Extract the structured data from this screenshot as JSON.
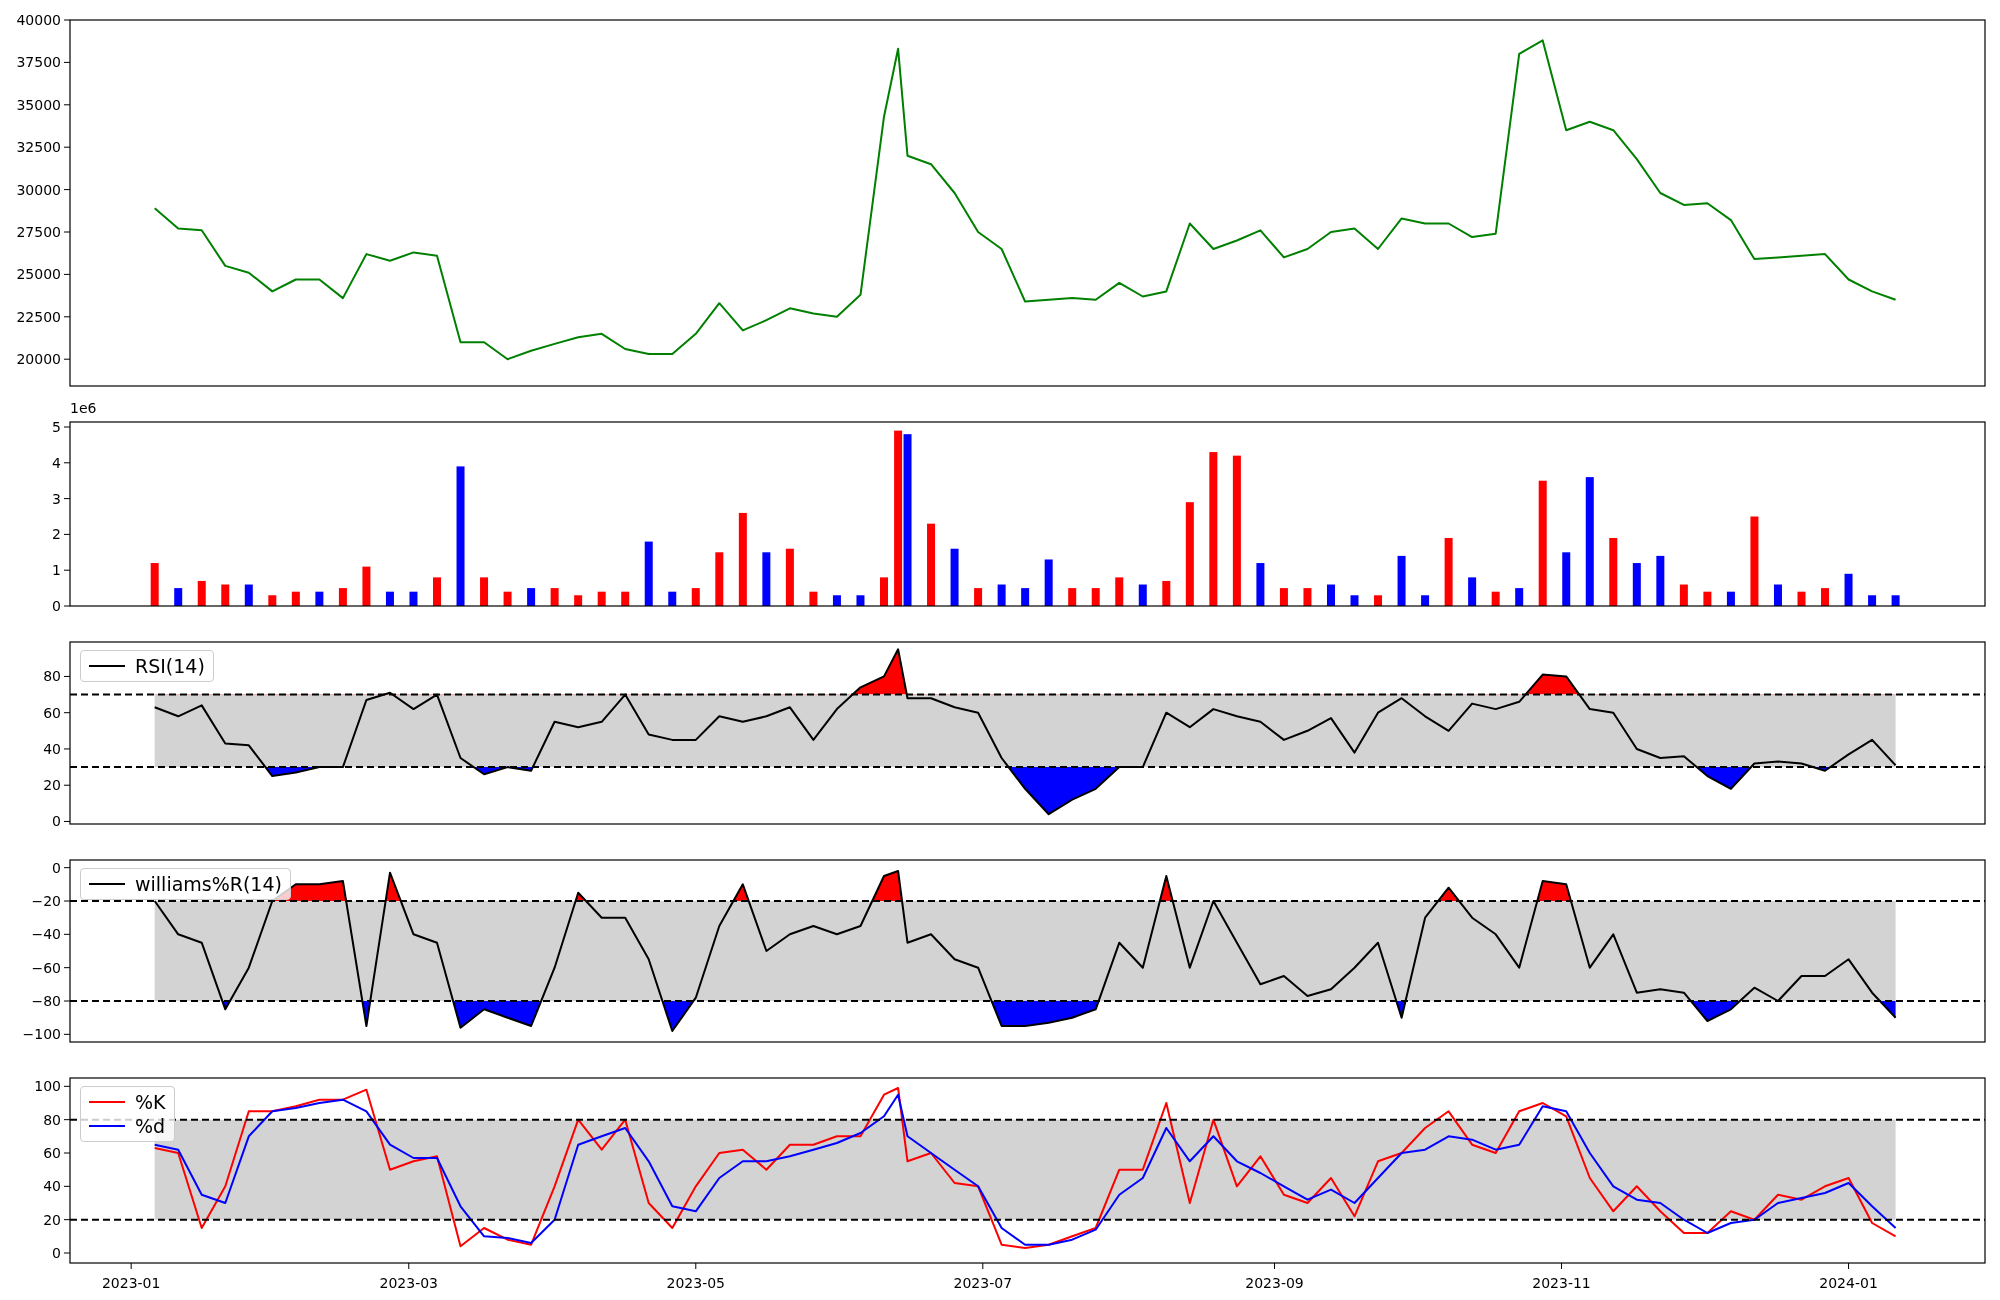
{
  "panels": [
    {
      "chart_data": {
        "type": "line",
        "x": [
          "2023-01-06",
          "2023-01-11",
          "2023-01-16",
          "2023-01-21",
          "2023-01-26",
          "2023-01-31",
          "2023-02-05",
          "2023-02-10",
          "2023-02-15",
          "2023-02-20",
          "2023-02-25",
          "2023-03-02",
          "2023-03-07",
          "2023-03-12",
          "2023-03-17",
          "2023-03-22",
          "2023-03-27",
          "2023-04-01",
          "2023-04-06",
          "2023-04-11",
          "2023-04-16",
          "2023-04-21",
          "2023-04-26",
          "2023-05-01",
          "2023-05-06",
          "2023-05-11",
          "2023-05-16",
          "2023-05-21",
          "2023-05-26",
          "2023-05-31",
          "2023-06-05",
          "2023-06-10",
          "2023-06-13",
          "2023-06-15",
          "2023-06-20",
          "2023-06-25",
          "2023-06-30",
          "2023-07-05",
          "2023-07-10",
          "2023-07-15",
          "2023-07-20",
          "2023-07-25",
          "2023-07-30",
          "2023-08-04",
          "2023-08-09",
          "2023-08-14",
          "2023-08-19",
          "2023-08-24",
          "2023-08-29",
          "2023-09-03",
          "2023-09-08",
          "2023-09-13",
          "2023-09-18",
          "2023-09-23",
          "2023-09-28",
          "2023-10-03",
          "2023-10-08",
          "2023-10-13",
          "2023-10-18",
          "2023-10-23",
          "2023-10-28",
          "2023-11-02",
          "2023-11-07",
          "2023-11-12",
          "2023-11-17",
          "2023-11-22",
          "2023-11-27",
          "2023-12-02",
          "2023-12-07",
          "2023-12-12",
          "2023-12-17",
          "2023-12-22",
          "2023-12-27",
          "2024-01-01",
          "2024-01-06",
          "2024-01-11"
        ],
        "xlim": [
          "2022-12-19",
          "2024-01-30"
        ],
        "ylim": [
          18420,
          40000
        ],
        "yticks": [
          20000,
          22500,
          25000,
          27500,
          30000,
          32500,
          35000,
          37500,
          40000
        ],
        "series": [
          {
            "color": "#008000",
            "values": [
              28900,
              27700,
              27600,
              25500,
              25100,
              24000,
              24700,
              24700,
              23600,
              26200,
              25800,
              26300,
              26100,
              21000,
              21000,
              20000,
              20500,
              20900,
              21300,
              21500,
              20600,
              20300,
              20300,
              21500,
              23300,
              21700,
              22300,
              23000,
              22700,
              22500,
              23800,
              34300,
              38300,
              32000,
              31500,
              29800,
              27500,
              26500,
              23400,
              23500,
              23600,
              23500,
              24500,
              23700,
              24000,
              28000,
              26500,
              27000,
              27600,
              26000,
              26500,
              27500,
              27700,
              26500,
              28300,
              28000,
              28000,
              27200,
              27400,
              38000,
              38800,
              33500,
              34000,
              33500,
              31800,
              29800,
              29100,
              29200,
              28200,
              25900,
              26000,
              26100,
              26200,
              24700,
              24000,
              23500
            ]
          }
        ]
      }
    },
    {
      "y_offset_label": "1e6",
      "chart_data": {
        "type": "bar",
        "x": [
          "2023-01-06",
          "2023-01-11",
          "2023-01-16",
          "2023-01-21",
          "2023-01-26",
          "2023-01-31",
          "2023-02-05",
          "2023-02-10",
          "2023-02-15",
          "2023-02-20",
          "2023-02-25",
          "2023-03-02",
          "2023-03-07",
          "2023-03-12",
          "2023-03-17",
          "2023-03-22",
          "2023-03-27",
          "2023-04-01",
          "2023-04-06",
          "2023-04-11",
          "2023-04-16",
          "2023-04-21",
          "2023-04-26",
          "2023-05-01",
          "2023-05-06",
          "2023-05-11",
          "2023-05-16",
          "2023-05-21",
          "2023-05-26",
          "2023-05-31",
          "2023-06-05",
          "2023-06-10",
          "2023-06-13",
          "2023-06-15",
          "2023-06-20",
          "2023-06-25",
          "2023-06-30",
          "2023-07-05",
          "2023-07-10",
          "2023-07-15",
          "2023-07-20",
          "2023-07-25",
          "2023-07-30",
          "2023-08-04",
          "2023-08-09",
          "2023-08-14",
          "2023-08-19",
          "2023-08-24",
          "2023-08-29",
          "2023-09-03",
          "2023-09-08",
          "2023-09-13",
          "2023-09-18",
          "2023-09-23",
          "2023-09-28",
          "2023-10-03",
          "2023-10-08",
          "2023-10-13",
          "2023-10-18",
          "2023-10-23",
          "2023-10-28",
          "2023-11-02",
          "2023-11-07",
          "2023-11-12",
          "2023-11-17",
          "2023-11-22",
          "2023-11-27",
          "2023-12-02",
          "2023-12-07",
          "2023-12-12",
          "2023-12-17",
          "2023-12-22",
          "2023-12-27",
          "2024-01-01",
          "2024-01-06",
          "2024-01-11"
        ],
        "xlim": [
          "2022-12-19",
          "2024-01-30"
        ],
        "ylim": [
          0,
          5.14
        ],
        "yticks": [
          0,
          1,
          2,
          3,
          4,
          5
        ],
        "series": [
          {
            "color": "#ff0000",
            "values": [
              1.2,
              null,
              0.7,
              0.6,
              null,
              0.3,
              0.4,
              null,
              0.5,
              1.1,
              null,
              null,
              0.8,
              null,
              0.8,
              0.4,
              null,
              0.5,
              0.3,
              0.4,
              0.4,
              null,
              null,
              0.5,
              1.5,
              2.6,
              null,
              1.6,
              0.4,
              null,
              null,
              0.8,
              4.9,
              null,
              2.3,
              null,
              0.5,
              null,
              null,
              null,
              0.5,
              0.5,
              0.8,
              null,
              0.7,
              2.9,
              4.3,
              4.2,
              null,
              0.5,
              0.5,
              null,
              null,
              0.3,
              null,
              null,
              1.9,
              null,
              0.4,
              null,
              3.5,
              null,
              null,
              1.9,
              null,
              null,
              0.6,
              0.4,
              null,
              2.5,
              null,
              0.4,
              0.5,
              null,
              null,
              null
            ]
          },
          {
            "color": "#0000ff",
            "values": [
              null,
              0.5,
              null,
              null,
              0.6,
              null,
              null,
              0.4,
              null,
              null,
              0.4,
              0.4,
              null,
              3.9,
              null,
              null,
              0.5,
              null,
              null,
              null,
              null,
              1.8,
              0.4,
              null,
              null,
              null,
              1.5,
              null,
              null,
              0.3,
              0.3,
              null,
              null,
              4.8,
              null,
              1.6,
              null,
              0.6,
              0.5,
              1.3,
              null,
              null,
              null,
              0.6,
              null,
              null,
              null,
              null,
              1.2,
              null,
              null,
              0.6,
              0.3,
              null,
              1.4,
              0.3,
              null,
              0.8,
              null,
              0.5,
              null,
              1.5,
              3.6,
              null,
              1.2,
              1.4,
              null,
              null,
              0.4,
              null,
              0.6,
              null,
              null,
              0.9,
              0.3,
              0.3
            ]
          }
        ]
      }
    },
    {
      "chart_data": {
        "type": "line",
        "x": [
          "2023-01-06",
          "2023-01-11",
          "2023-01-16",
          "2023-01-21",
          "2023-01-26",
          "2023-01-31",
          "2023-02-05",
          "2023-02-10",
          "2023-02-15",
          "2023-02-20",
          "2023-02-25",
          "2023-03-02",
          "2023-03-07",
          "2023-03-12",
          "2023-03-17",
          "2023-03-22",
          "2023-03-27",
          "2023-04-01",
          "2023-04-06",
          "2023-04-11",
          "2023-04-16",
          "2023-04-21",
          "2023-04-26",
          "2023-05-01",
          "2023-05-06",
          "2023-05-11",
          "2023-05-16",
          "2023-05-21",
          "2023-05-26",
          "2023-05-31",
          "2023-06-05",
          "2023-06-10",
          "2023-06-13",
          "2023-06-15",
          "2023-06-20",
          "2023-06-25",
          "2023-06-30",
          "2023-07-05",
          "2023-07-10",
          "2023-07-15",
          "2023-07-20",
          "2023-07-25",
          "2023-07-30",
          "2023-08-04",
          "2023-08-09",
          "2023-08-14",
          "2023-08-19",
          "2023-08-24",
          "2023-08-29",
          "2023-09-03",
          "2023-09-08",
          "2023-09-13",
          "2023-09-18",
          "2023-09-23",
          "2023-09-28",
          "2023-10-03",
          "2023-10-08",
          "2023-10-13",
          "2023-10-18",
          "2023-10-23",
          "2023-10-28",
          "2023-11-02",
          "2023-11-07",
          "2023-11-12",
          "2023-11-17",
          "2023-11-22",
          "2023-11-27",
          "2023-12-02",
          "2023-12-07",
          "2023-12-12",
          "2023-12-17",
          "2023-12-22",
          "2023-12-27",
          "2024-01-01",
          "2024-01-06",
          "2024-01-11"
        ],
        "xlim": [
          "2022-12-19",
          "2024-01-30"
        ],
        "ylim": [
          -1.4,
          99
        ],
        "yticks": [
          0,
          20,
          40,
          60,
          80
        ],
        "series": [
          {
            "name": "RSI(14)",
            "color": "#000000",
            "values": [
              63,
              58,
              64,
              43,
              42,
              25,
              27,
              30,
              30,
              67,
              71,
              62,
              70,
              35,
              26,
              30,
              28,
              55,
              52,
              55,
              70,
              48,
              45,
              45,
              58,
              55,
              58,
              63,
              45,
              62,
              74,
              80,
              95,
              68,
              68,
              63,
              60,
              35,
              18,
              4,
              12,
              18,
              30,
              30,
              60,
              52,
              62,
              58,
              55,
              45,
              50,
              57,
              38,
              60,
              68,
              58,
              50,
              65,
              62,
              66,
              81,
              80,
              62,
              60,
              40,
              35,
              36,
              25,
              18,
              32,
              33,
              32,
              28,
              37,
              45,
              31
            ]
          }
        ],
        "bands": [
          {
            "axis": "y",
            "from": 30,
            "to": 70
          }
        ],
        "ref_lines": [
          {
            "axis": "y",
            "value": 70
          },
          {
            "axis": "y",
            "value": 30
          }
        ]
      },
      "zone_fills": [
        {
          "above": true,
          "color": "#ff0000"
        },
        {
          "above": false,
          "color": "#0000ff"
        }
      ]
    },
    {
      "chart_data": {
        "type": "line",
        "x": [
          "2023-01-06",
          "2023-01-11",
          "2023-01-16",
          "2023-01-21",
          "2023-01-26",
          "2023-01-31",
          "2023-02-05",
          "2023-02-10",
          "2023-02-15",
          "2023-02-20",
          "2023-02-25",
          "2023-03-02",
          "2023-03-07",
          "2023-03-12",
          "2023-03-17",
          "2023-03-22",
          "2023-03-27",
          "2023-04-01",
          "2023-04-06",
          "2023-04-11",
          "2023-04-16",
          "2023-04-21",
          "2023-04-26",
          "2023-05-01",
          "2023-05-06",
          "2023-05-11",
          "2023-05-16",
          "2023-05-21",
          "2023-05-26",
          "2023-05-31",
          "2023-06-05",
          "2023-06-10",
          "2023-06-13",
          "2023-06-15",
          "2023-06-20",
          "2023-06-25",
          "2023-06-30",
          "2023-07-05",
          "2023-07-10",
          "2023-07-15",
          "2023-07-20",
          "2023-07-25",
          "2023-07-30",
          "2023-08-04",
          "2023-08-09",
          "2023-08-14",
          "2023-08-19",
          "2023-08-24",
          "2023-08-29",
          "2023-09-03",
          "2023-09-08",
          "2023-09-13",
          "2023-09-18",
          "2023-09-23",
          "2023-09-28",
          "2023-10-03",
          "2023-10-08",
          "2023-10-13",
          "2023-10-18",
          "2023-10-23",
          "2023-10-28",
          "2023-11-02",
          "2023-11-07",
          "2023-11-12",
          "2023-11-17",
          "2023-11-22",
          "2023-11-27",
          "2023-12-02",
          "2023-12-07",
          "2023-12-12",
          "2023-12-17",
          "2023-12-22",
          "2023-12-27",
          "2024-01-01",
          "2024-01-06",
          "2024-01-11"
        ],
        "xlim": [
          "2022-12-19",
          "2024-01-30"
        ],
        "ylim": [
          -104.6,
          4.6
        ],
        "yticks": [
          {
            "value": -100,
            "label": "−100"
          },
          {
            "value": -80,
            "label": "−80"
          },
          {
            "value": -60,
            "label": "−60"
          },
          {
            "value": -40,
            "label": "−40"
          },
          {
            "value": -20,
            "label": "−20"
          },
          {
            "value": 0,
            "label": "0"
          }
        ],
        "series": [
          {
            "name": "williams%R(14)",
            "color": "#000000",
            "values": [
              -20,
              -40,
              -45,
              -85,
              -60,
              -20,
              -10,
              -10,
              -8,
              -95,
              -3,
              -40,
              -45,
              -96,
              -85,
              -90,
              -95,
              -60,
              -15,
              -30,
              -30,
              -55,
              -98,
              -78,
              -35,
              -10,
              -50,
              -40,
              -35,
              -40,
              -35,
              -5,
              -2,
              -45,
              -40,
              -55,
              -60,
              -95,
              -95,
              -93,
              -90,
              -85,
              -45,
              -60,
              -5,
              -60,
              -20,
              -45,
              -70,
              -65,
              -77,
              -73,
              -60,
              -45,
              -90,
              -30,
              -12,
              -30,
              -40,
              -60,
              -8,
              -10,
              -60,
              -40,
              -75,
              -73,
              -75,
              -92,
              -85,
              -72,
              -80,
              -65,
              -65,
              -55,
              -75,
              -90
            ]
          }
        ],
        "bands": [
          {
            "axis": "y",
            "from": -80,
            "to": -20
          }
        ],
        "ref_lines": [
          {
            "axis": "y",
            "value": -20
          },
          {
            "axis": "y",
            "value": -80
          }
        ]
      },
      "zone_fills": [
        {
          "above": true,
          "color": "#ff0000"
        },
        {
          "above": false,
          "color": "#0000ff"
        }
      ]
    },
    {
      "chart_data": {
        "type": "line",
        "x": [
          "2023-01-06",
          "2023-01-11",
          "2023-01-16",
          "2023-01-21",
          "2023-01-26",
          "2023-01-31",
          "2023-02-05",
          "2023-02-10",
          "2023-02-15",
          "2023-02-20",
          "2023-02-25",
          "2023-03-02",
          "2023-03-07",
          "2023-03-12",
          "2023-03-17",
          "2023-03-22",
          "2023-03-27",
          "2023-04-01",
          "2023-04-06",
          "2023-04-11",
          "2023-04-16",
          "2023-04-21",
          "2023-04-26",
          "2023-05-01",
          "2023-05-06",
          "2023-05-11",
          "2023-05-16",
          "2023-05-21",
          "2023-05-26",
          "2023-05-31",
          "2023-06-05",
          "2023-06-10",
          "2023-06-13",
          "2023-06-15",
          "2023-06-20",
          "2023-06-25",
          "2023-06-30",
          "2023-07-05",
          "2023-07-10",
          "2023-07-15",
          "2023-07-20",
          "2023-07-25",
          "2023-07-30",
          "2023-08-04",
          "2023-08-09",
          "2023-08-14",
          "2023-08-19",
          "2023-08-24",
          "2023-08-29",
          "2023-09-03",
          "2023-09-08",
          "2023-09-13",
          "2023-09-18",
          "2023-09-23",
          "2023-09-28",
          "2023-10-03",
          "2023-10-08",
          "2023-10-13",
          "2023-10-18",
          "2023-10-23",
          "2023-10-28",
          "2023-11-02",
          "2023-11-07",
          "2023-11-12",
          "2023-11-17",
          "2023-11-22",
          "2023-11-27",
          "2023-12-02",
          "2023-12-07",
          "2023-12-12",
          "2023-12-17",
          "2023-12-22",
          "2023-12-27",
          "2024-01-01",
          "2024-01-06",
          "2024-01-11"
        ],
        "xlim": [
          "2022-12-19",
          "2024-01-30"
        ],
        "ylim": [
          -6,
          105
        ],
        "yticks": [
          0,
          20,
          40,
          60,
          80,
          100
        ],
        "xticks": [
          {
            "value": "2023-01-01",
            "label": "2023-01"
          },
          {
            "value": "2023-03-01",
            "label": "2023-03"
          },
          {
            "value": "2023-05-01",
            "label": "2023-05"
          },
          {
            "value": "2023-07-01",
            "label": "2023-07"
          },
          {
            "value": "2023-09-01",
            "label": "2023-09"
          },
          {
            "value": "2023-11-01",
            "label": "2023-11"
          },
          {
            "value": "2024-01-01",
            "label": "2024-01"
          }
        ],
        "series": [
          {
            "name": "%K",
            "color": "#ff0000",
            "values": [
              63,
              60,
              15,
              40,
              85,
              85,
              88,
              92,
              92,
              98,
              50,
              55,
              58,
              4,
              15,
              8,
              5,
              40,
              80,
              62,
              80,
              30,
              15,
              40,
              60,
              62,
              50,
              65,
              65,
              70,
              70,
              95,
              99,
              55,
              60,
              42,
              40,
              5,
              3,
              5,
              10,
              15,
              50,
              50,
              90,
              30,
              80,
              40,
              58,
              35,
              30,
              45,
              22,
              55,
              60,
              75,
              85,
              65,
              60,
              85,
              90,
              82,
              45,
              25,
              40,
              25,
              12,
              12,
              25,
              20,
              35,
              32,
              40,
              45,
              18,
              10
            ]
          },
          {
            "name": "%d",
            "color": "#0000ff",
            "values": [
              65,
              62,
              35,
              30,
              70,
              85,
              87,
              90,
              92,
              85,
              65,
              57,
              57,
              28,
              10,
              9,
              6,
              20,
              65,
              70,
              75,
              55,
              28,
              25,
              45,
              55,
              55,
              58,
              62,
              66,
              72,
              82,
              95,
              70,
              60,
              50,
              40,
              15,
              5,
              5,
              8,
              14,
              35,
              45,
              75,
              55,
              70,
              55,
              48,
              40,
              32,
              38,
              30,
              45,
              60,
              62,
              70,
              68,
              62,
              65,
              88,
              85,
              60,
              40,
              32,
              30,
              20,
              12,
              18,
              20,
              30,
              33,
              36,
              42,
              28,
              15
            ]
          }
        ],
        "bands": [
          {
            "axis": "y",
            "from": 20,
            "to": 80
          }
        ],
        "ref_lines": [
          {
            "axis": "y",
            "value": 80
          },
          {
            "axis": "y",
            "value": 20
          }
        ]
      }
    }
  ]
}
